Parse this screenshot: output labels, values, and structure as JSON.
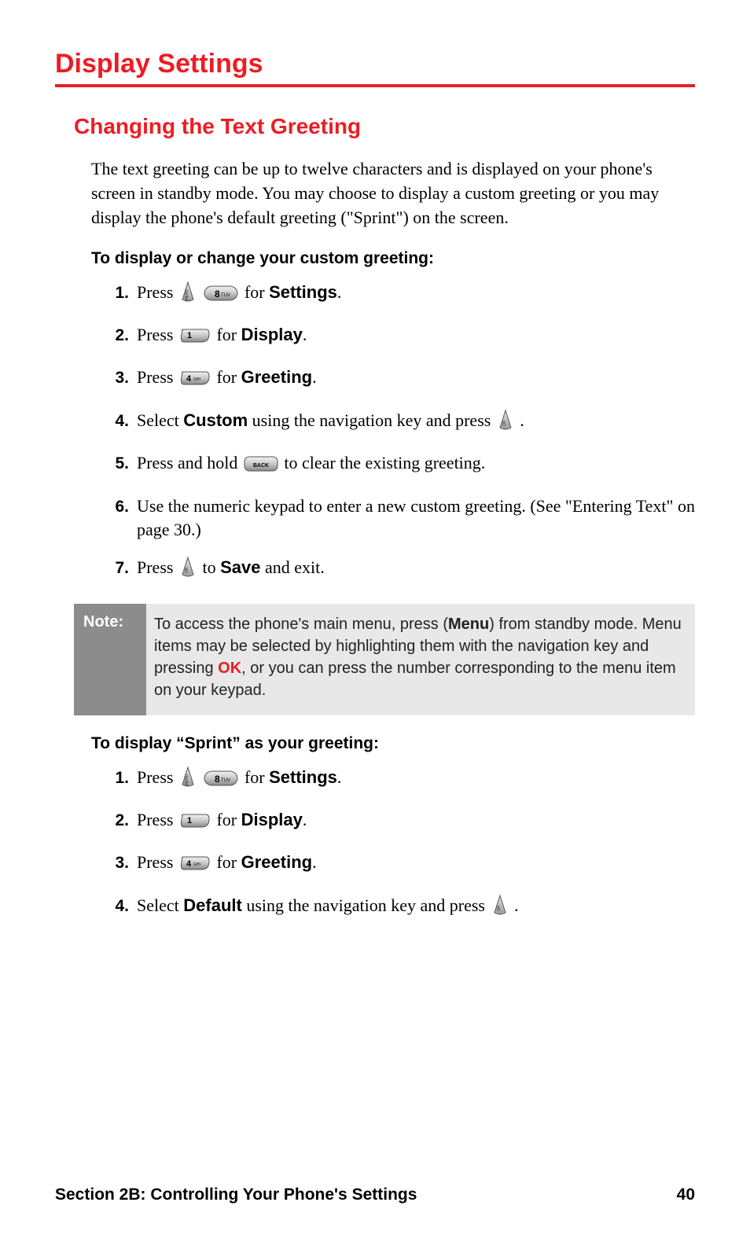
{
  "title": "Display Settings",
  "subtitle": "Changing the Text Greeting",
  "intro": "The text greeting can be up to twelve characters and is displayed on your phone's screen in standby mode. You may choose to display a custom greeting or you may display the phone's default greeting (\"Sprint\") on the screen.",
  "lead_custom": "To display or change your custom greeting:",
  "steps_custom": {
    "s1": {
      "num": "1.",
      "press": "Press ",
      "for_": " for ",
      "target": "Settings",
      "dot": "."
    },
    "s2": {
      "num": "2.",
      "press": "Press ",
      "for_": " for ",
      "target": "Display",
      "dot": "."
    },
    "s3": {
      "num": "3.",
      "press": "Press ",
      "for_": " for ",
      "target": "Greeting",
      "dot": "."
    },
    "s4": {
      "num": "4.",
      "pre": "Select ",
      "word": "Custom",
      "post": " using the navigation key and press ",
      "dot": "."
    },
    "s5": {
      "num": "5.",
      "pre": "Press and hold ",
      "post": " to clear the existing greeting."
    },
    "s6": {
      "num": "6.",
      "text": "Use the numeric keypad to enter a new custom greeting. (See \"Entering Text\" on page 30.)"
    },
    "s7": {
      "num": "7.",
      "press": "Press ",
      "to_": " to ",
      "word": "Save",
      "post": " and exit."
    }
  },
  "note": {
    "label": "Note:",
    "t1": "To access the phone's main menu, press (",
    "menu": "Menu",
    "t2": ") from standby mode. Menu items may be selected by highlighting them with the navigation key and pressing ",
    "ok": "OK",
    "t3": ", or you can press the number corresponding to the menu item on your keypad."
  },
  "lead_sprint": "To display “Sprint” as your greeting:",
  "steps_sprint": {
    "s1": {
      "num": "1.",
      "press": "Press ",
      "for_": " for ",
      "target": "Settings",
      "dot": "."
    },
    "s2": {
      "num": "2.",
      "press": "Press ",
      "for_": " for ",
      "target": "Display",
      "dot": "."
    },
    "s3": {
      "num": "3.",
      "press": "Press ",
      "for_": " for ",
      "target": "Greeting",
      "dot": "."
    },
    "s4": {
      "num": "4.",
      "pre": "Select ",
      "word": "Default",
      "post": " using the navigation key and press ",
      "dot": "."
    }
  },
  "key_labels": {
    "k8": "8",
    "k8_sub": "TUV",
    "k1": "1",
    "k4": "4",
    "k4_sub": "GHI",
    "back": "BACK"
  },
  "footer": {
    "section": "Section 2B: Controlling Your Phone's Settings",
    "page": "40"
  }
}
